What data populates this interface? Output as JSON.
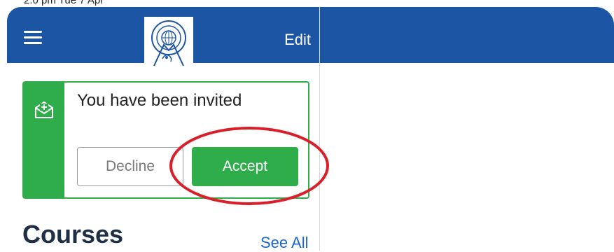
{
  "status_bar": {
    "time_text": "2:0 pm  Tue 7 Apr"
  },
  "nav": {
    "edit_label": "Edit",
    "logo_icon": "sydney-distance-education-logo",
    "menu_icon": "hamburger-menu-icon",
    "bar_color": "#1c55a4"
  },
  "invite": {
    "title": "You have been invited",
    "icon": "envelope-plus-icon",
    "decline_label": "Decline",
    "accept_label": "Accept",
    "accent_color": "#2fad4b"
  },
  "courses": {
    "heading": "Courses",
    "see_all_label": "See All"
  },
  "annotation": {
    "highlight_color": "#d9202a",
    "highlight_target": "accept-button"
  }
}
